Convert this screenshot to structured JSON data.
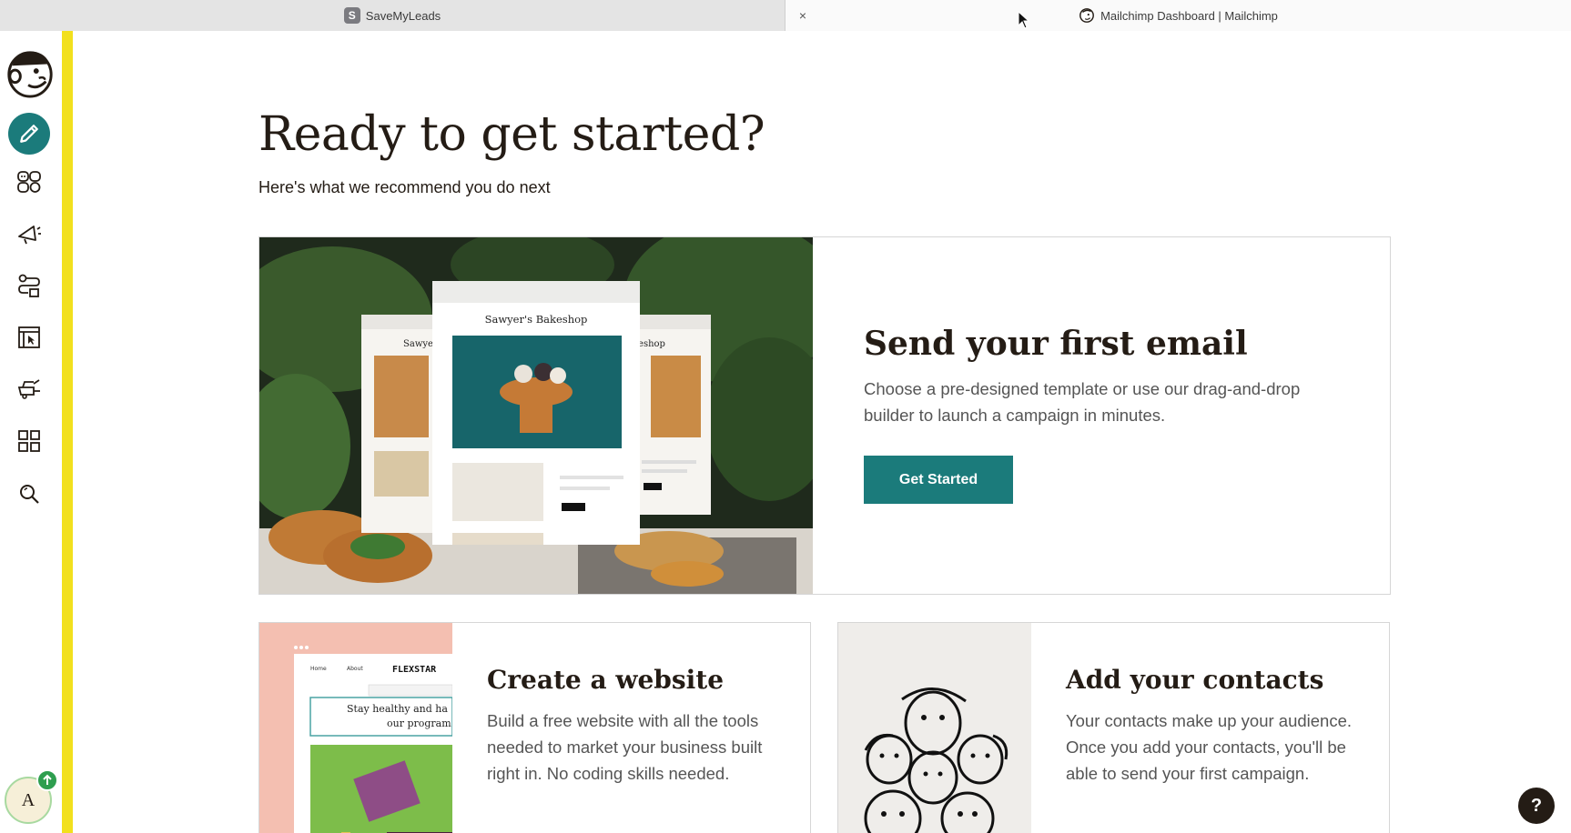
{
  "browser": {
    "tabs": [
      {
        "label": "SaveMyLeads",
        "favicon": "S"
      },
      {
        "label": "Mailchimp Dashboard | Mailchimp"
      }
    ],
    "close_glyph": "×"
  },
  "sidebar": {
    "items": [
      {
        "name": "create",
        "icon": "pencil-icon"
      },
      {
        "name": "audience",
        "icon": "audience-icon"
      },
      {
        "name": "campaigns",
        "icon": "megaphone-icon"
      },
      {
        "name": "automations",
        "icon": "automations-icon"
      },
      {
        "name": "website",
        "icon": "website-icon"
      },
      {
        "name": "integrations",
        "icon": "integrations-icon"
      },
      {
        "name": "all-apps",
        "icon": "grid-icon"
      },
      {
        "name": "search",
        "icon": "search-icon"
      }
    ],
    "avatar_initial": "A",
    "accent_color": "#f2e01d"
  },
  "main": {
    "title": "Ready to get started?",
    "subtitle": "Here's what we recommend you do next",
    "hero": {
      "title": "Send your first email",
      "text": "Choose a pre-designed template or use our drag-and-drop builder to launch a campaign in minutes.",
      "button": "Get Started",
      "image": {
        "template_title": "Sawyer's Bakeshop",
        "left_fragment": "Sawyer'",
        "right_fragment": "akeshop"
      }
    },
    "cards": [
      {
        "title": "Create a website",
        "text": "Build a free website with all the tools needed to market your business built right in. No coding skills needed.",
        "image": {
          "brand": "FLEXSTAR",
          "nav_home": "Home",
          "nav_about": "About",
          "headline_1": "Stay healthy and ha",
          "headline_2": "our program"
        }
      },
      {
        "title": "Add your contacts",
        "text": "Your contacts make up your audience. Once you add your contacts, you'll be able to send your first campaign."
      }
    ]
  },
  "help_label": "?",
  "colors": {
    "brand_teal": "#1b7b7b",
    "text_dark": "#241c15",
    "text_muted": "#555555"
  }
}
